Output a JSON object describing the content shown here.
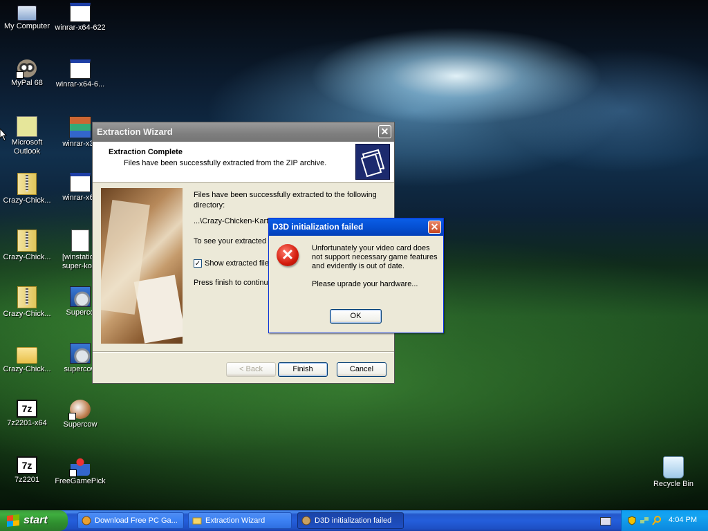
{
  "desktop": {
    "icons": [
      {
        "label": "My Computer",
        "icon": "my-computer-icon"
      },
      {
        "label": "winrar-x64-622",
        "icon": "window-icon"
      },
      {
        "label": "MyPal 68",
        "icon": "raccoon-icon"
      },
      {
        "label": "winrar-x64-6...",
        "icon": "window-icon"
      },
      {
        "label": "Microsoft",
        "label2": "Outlook",
        "icon": "outlook-icon"
      },
      {
        "label": "winrar-x32",
        "icon": "winrar-icon"
      },
      {
        "label": "Crazy-Chick...",
        "icon": "zip-icon"
      },
      {
        "label": "winrar-x64",
        "icon": "window-icon"
      },
      {
        "label": "Crazy-Chick...",
        "icon": "zip-icon"
      },
      {
        "label": "[winstation",
        "label2": "super-korc",
        "icon": "document-icon"
      },
      {
        "label": "Crazy-Chick...",
        "icon": "zip-icon"
      },
      {
        "label": "Superco",
        "icon": "setup-icon"
      },
      {
        "label": "Crazy-Chick...",
        "icon": "folder-icon"
      },
      {
        "label": "supercow",
        "icon": "setup-icon"
      },
      {
        "label": "7z2201-x64",
        "icon": "7zip-icon"
      },
      {
        "label": "Supercow",
        "icon": "supercow-icon"
      },
      {
        "label": "7z2201",
        "icon": "7zip-icon"
      },
      {
        "label": "FreeGamePick",
        "icon": "joystick-icon"
      },
      {
        "label": "Recycle Bin",
        "icon": "recycle-bin-icon"
      }
    ]
  },
  "wizard": {
    "title": "Extraction Wizard",
    "close_label": "✕",
    "header_title": "Extraction Complete",
    "header_subtitle": "Files have been successfully extracted from the ZIP archive.",
    "body_line1": "Files have been successfully extracted to the following directory:",
    "body_path": "...\\Crazy-Chicken-Kart-2",
    "body_line2": "To see your extracted",
    "checkbox_label": "Show extracted file",
    "checkbox_checked": true,
    "checkbox_mark": "✓",
    "body_line3": "Press finish to continue",
    "back_label": "< Back",
    "finish_label": "Finish",
    "cancel_label": "Cancel"
  },
  "d3d_dialog": {
    "title": "D3D initialization failed",
    "close_label": "✕",
    "error_glyph": "✕",
    "message": "Unfortunately your video card does not support necessary game features and evidently is out of date.",
    "message2": "Please uprade your hardware...",
    "ok_label": "OK"
  },
  "taskbar": {
    "start_label": "start",
    "tasks": [
      {
        "label": "Download Free PC Ga...",
        "active": false
      },
      {
        "label": "Extraction Wizard",
        "active": false
      },
      {
        "label": "D3D initialization failed",
        "active": true
      }
    ],
    "clock": "4:04 PM"
  },
  "colors": {
    "xp_blue": "#245edb",
    "start_green": "#3fae3f",
    "dialog_face": "#ece9d8",
    "error_red": "#d31b0c"
  }
}
